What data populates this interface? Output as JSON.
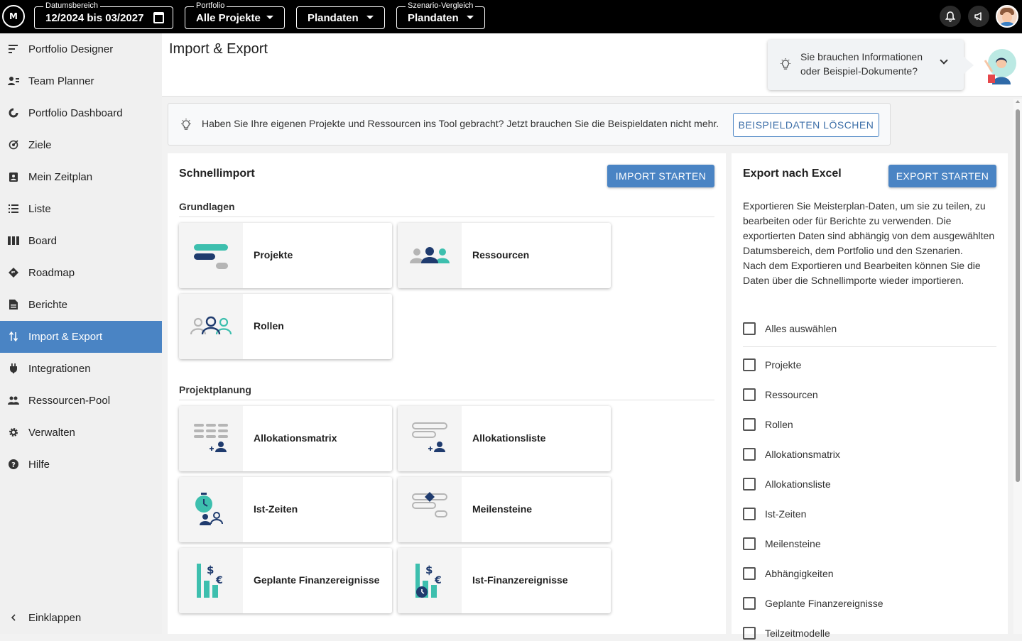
{
  "topbar": {
    "logo": "M",
    "date_range": {
      "legend": "Datumsbereich",
      "value": "12/2024 bis 03/2027"
    },
    "portfolio": {
      "legend": "Portfolio",
      "value": "Alle Projekte"
    },
    "plan": {
      "value": "Plandaten"
    },
    "scenario": {
      "legend": "Szenario-Vergleich",
      "value": "Plandaten"
    },
    "icons": [
      "bell-icon",
      "megaphone-icon",
      "user-avatar"
    ]
  },
  "sidebar": {
    "items": [
      {
        "label": "Portfolio Designer",
        "icon": "portfolio-designer-icon"
      },
      {
        "label": "Team Planner",
        "icon": "team-planner-icon"
      },
      {
        "label": "Portfolio Dashboard",
        "icon": "dashboard-icon"
      },
      {
        "label": "Ziele",
        "icon": "target-icon"
      },
      {
        "label": "Mein Zeitplan",
        "icon": "schedule-icon"
      },
      {
        "label": "Liste",
        "icon": "list-icon"
      },
      {
        "label": "Board",
        "icon": "board-icon"
      },
      {
        "label": "Roadmap",
        "icon": "roadmap-icon"
      },
      {
        "label": "Berichte",
        "icon": "report-icon"
      },
      {
        "label": "Import & Export",
        "icon": "import-export-icon",
        "active": true
      },
      {
        "label": "Integrationen",
        "icon": "plug-icon"
      },
      {
        "label": "Ressourcen-Pool",
        "icon": "people-icon"
      },
      {
        "label": "Verwalten",
        "icon": "gear-icon"
      },
      {
        "label": "Hilfe",
        "icon": "help-icon"
      }
    ],
    "collapse_label": "Einklappen"
  },
  "page": {
    "title": "Import & Export",
    "help_text": "Sie brauchen Informationen oder Beispiel-Dokumente?"
  },
  "banner": {
    "text": "Haben Sie Ihre eigenen Projekte und Ressourcen ins Tool gebracht? Jetzt brauchen Sie die Beispieldaten nicht mehr.",
    "button": "BEISPIELDATEN LÖSCHEN"
  },
  "quick_import": {
    "title": "Schnellimport",
    "button": "IMPORT STARTEN",
    "sections": [
      {
        "title": "Grundlagen",
        "cards": [
          "Projekte",
          "Ressourcen",
          "Rollen"
        ]
      },
      {
        "title": "Projektplanung",
        "cards": [
          "Allokationsmatrix",
          "Allokationsliste",
          "Ist-Zeiten",
          "Meilensteine",
          "Geplante Finanzereignisse",
          "Ist-Finanzereignisse"
        ]
      }
    ]
  },
  "export": {
    "title": "Export nach Excel",
    "button": "EXPORT STARTEN",
    "description_1": "Exportieren Sie Meisterplan-Daten, um sie zu teilen, zu bearbeiten oder für Berichte zu verwenden. Die exportierten Daten sind abhängig von dem ausgewählten Datumsbereich, dem Portfolio und den Szenarien.",
    "description_2": "Nach dem Exportieren und Bearbeiten können Sie die Daten über die Schnellimporte wieder importieren.",
    "select_all": "Alles auswählen",
    "options": [
      "Projekte",
      "Ressourcen",
      "Rollen",
      "Allokationsmatrix",
      "Allokationsliste",
      "Ist-Zeiten",
      "Meilensteine",
      "Abhängigkeiten",
      "Geplante Finanzereignisse",
      "Teilzeitmodelle"
    ]
  },
  "colors": {
    "accent": "#4a84c4",
    "teal": "#3dbfae",
    "navy": "#1f3b6e",
    "grey": "#b5b5b5"
  }
}
